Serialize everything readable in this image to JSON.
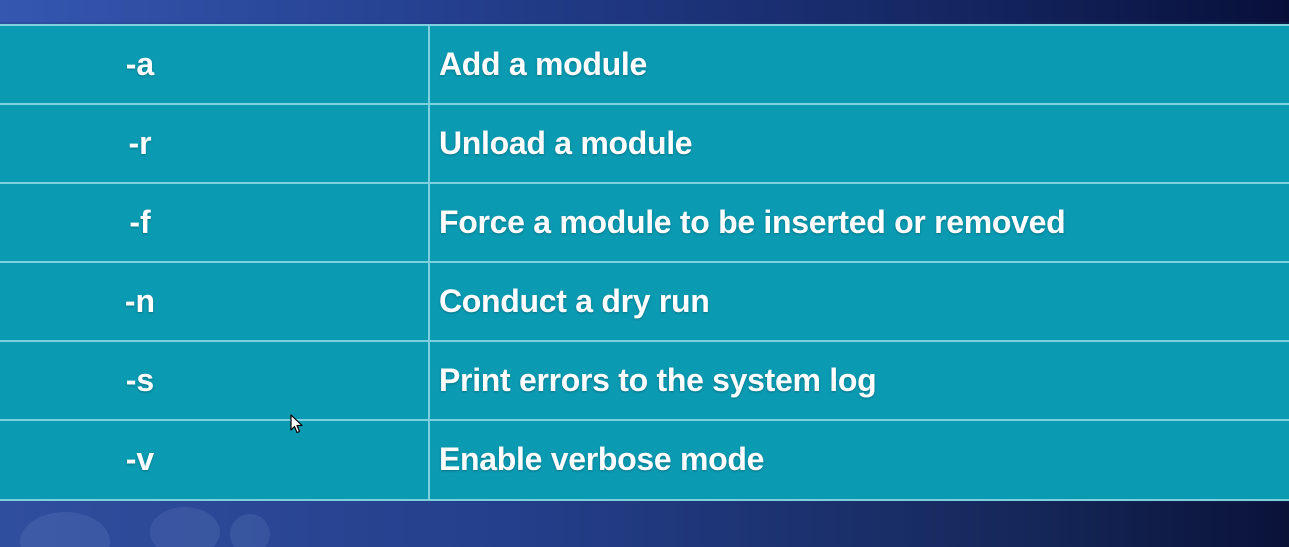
{
  "colors": {
    "table_bg": "#0a9ab2",
    "grid_line": "#7fd0dd",
    "text": "#ffffff",
    "background_left": "#2f4fa3",
    "background_right": "#0d1a45"
  },
  "options_table": {
    "rows": [
      {
        "flag": "-a",
        "description": "Add a module"
      },
      {
        "flag": "-r",
        "description": "Unload a module"
      },
      {
        "flag": "-f",
        "description": "Force a module to be inserted or removed"
      },
      {
        "flag": "-n",
        "description": "Conduct a dry run"
      },
      {
        "flag": "-s",
        "description": "Print errors to the system log"
      },
      {
        "flag": "-v",
        "description": "Enable verbose mode"
      }
    ]
  },
  "cursor": {
    "icon": "mouse-pointer-icon"
  }
}
